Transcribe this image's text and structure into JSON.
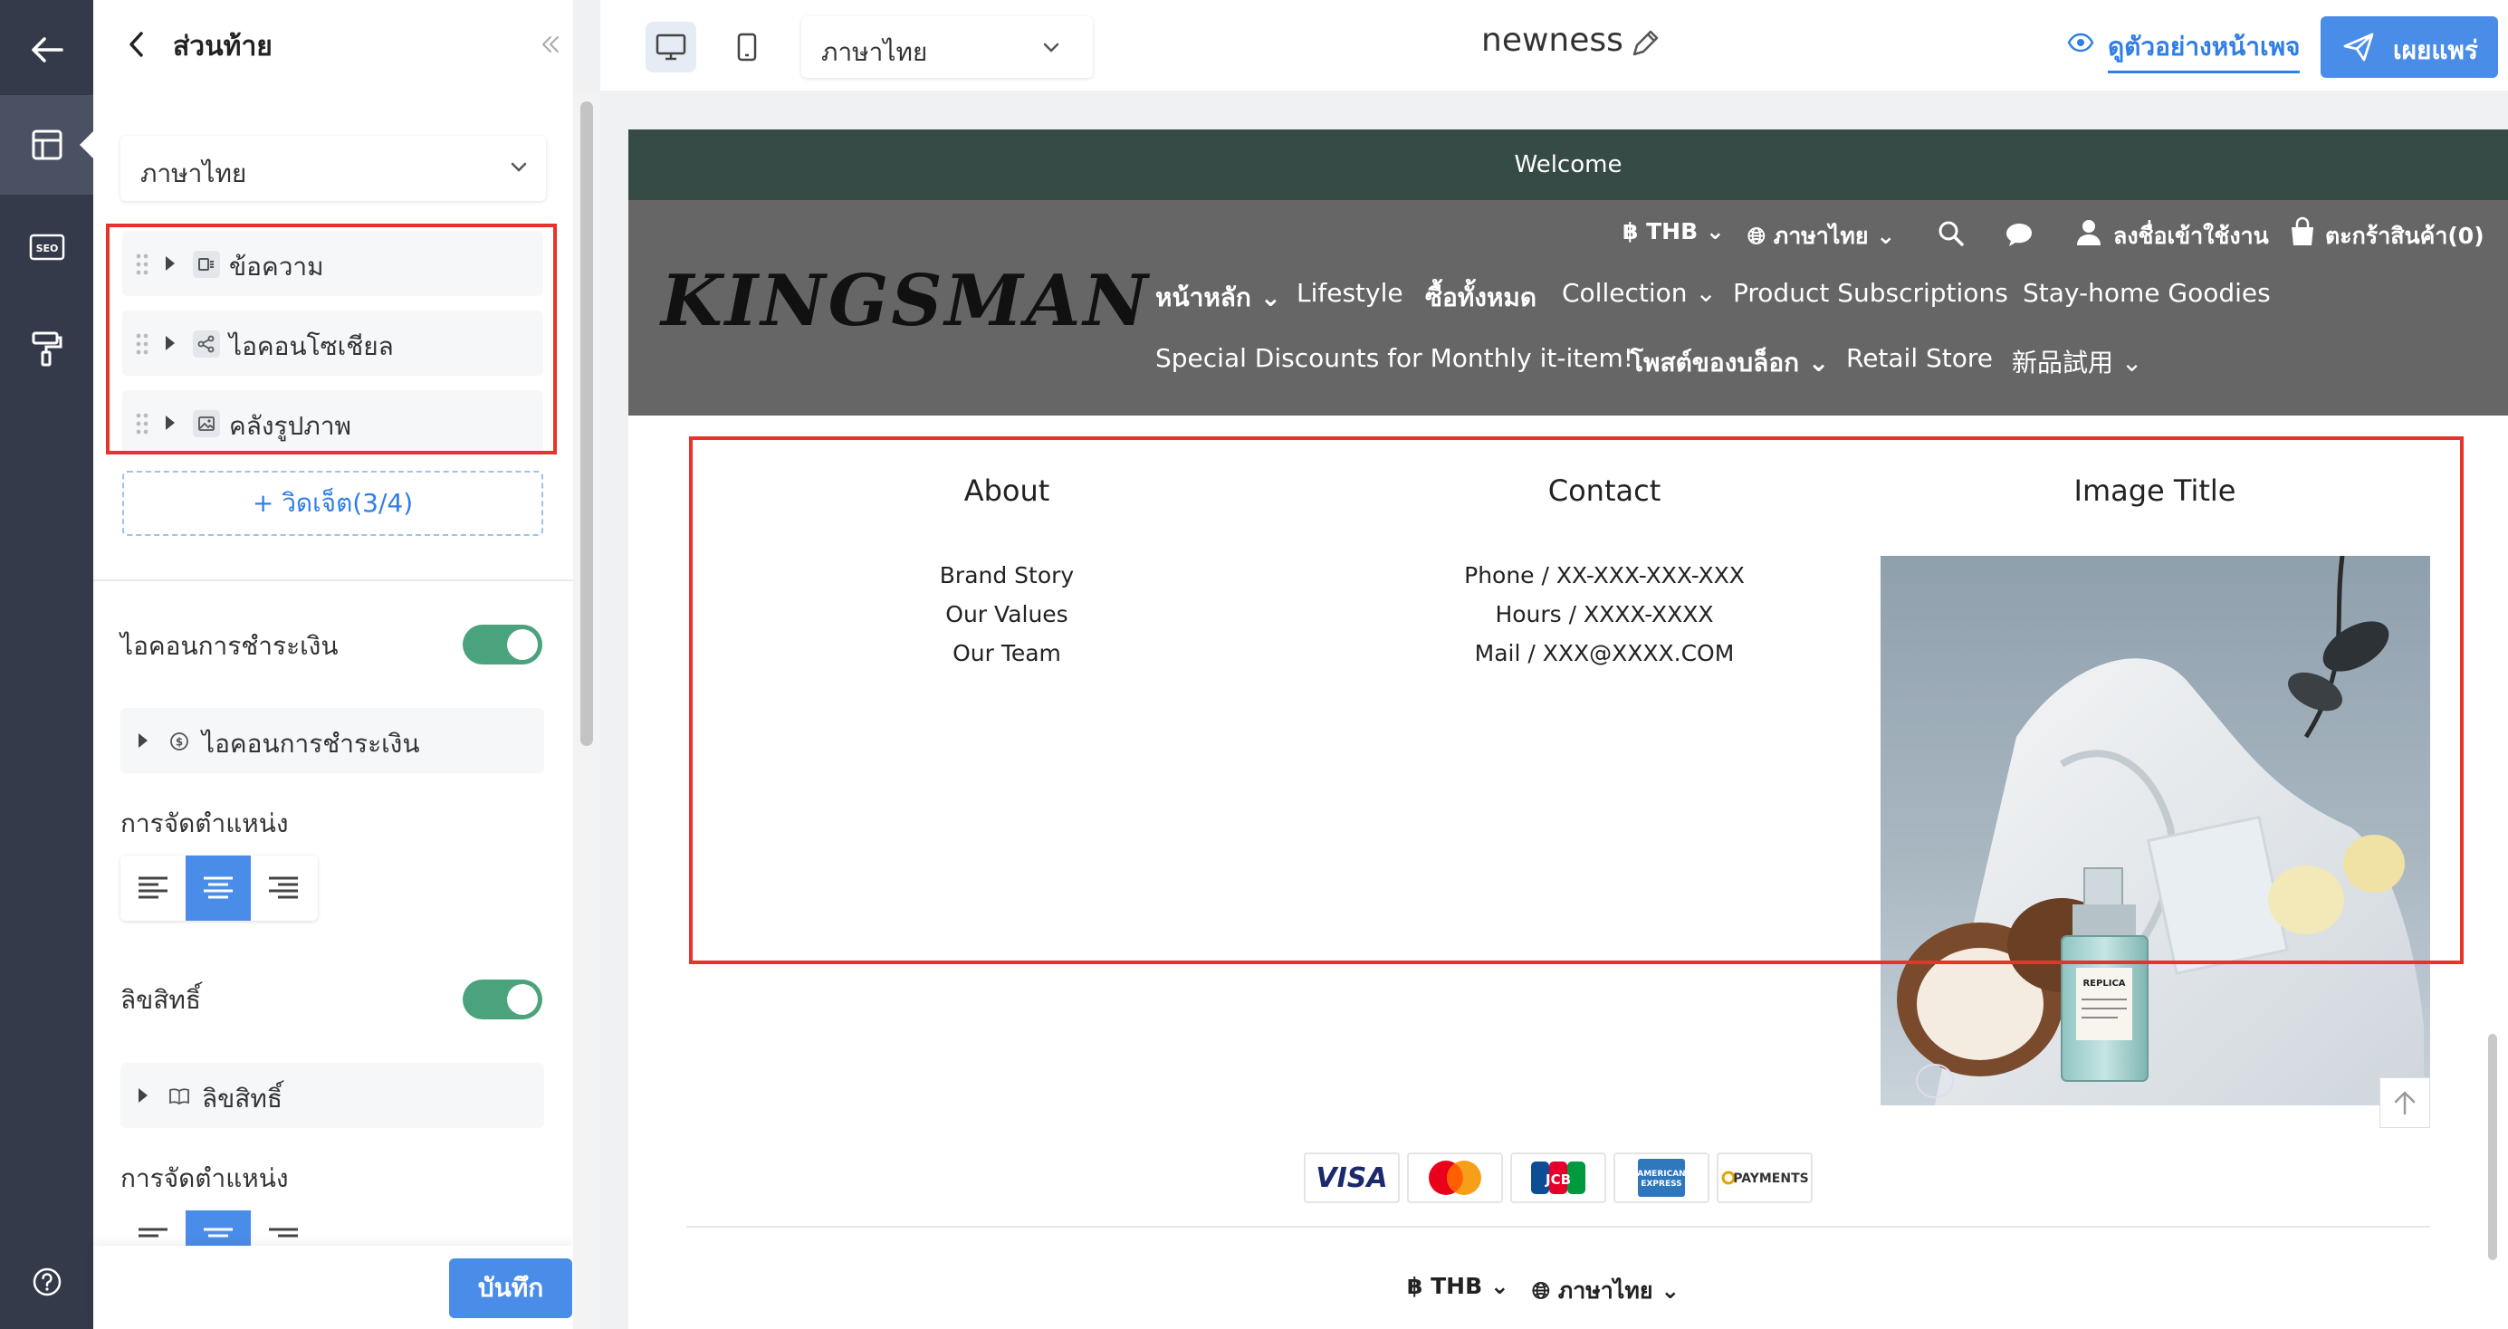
{
  "sidebar": {
    "title": "ส่วนท้าย",
    "language_select": "ภาษาไทย",
    "widgets": [
      {
        "label": "ข้อความ",
        "icon": "text-widget-icon"
      },
      {
        "label": "ไอคอนโซเชียล",
        "icon": "share-icon"
      },
      {
        "label": "คลังรูปภาพ",
        "icon": "image-icon"
      }
    ],
    "add_widget": "+ วิดเจ็ต(3/4)",
    "payment_icons_label": "ไอคอนการชำระเงิน",
    "payment_icons_row": "ไอคอนการชำระเงิน",
    "alignment_label": "การจัดตำแหน่ง",
    "copyright_label": "ลิขสิทธิ์",
    "copyright_row": "ลิขสิทธิ์",
    "alignment_label_2": "การจัดตำแหน่ง",
    "save": "บันทึก"
  },
  "toolbar": {
    "language_select": "ภาษาไทย",
    "page_name": "newness",
    "preview": "ดูตัวอย่างหน้าเพจ",
    "publish": "เผยแพร่"
  },
  "store": {
    "welcome": "Welcome",
    "logo": "KINGSMAN",
    "currency": "฿ THB",
    "language": "ภาษาไทย",
    "login": "ลงชื่อเข้าใช้งาน",
    "cart": "ตะกร้าสินค้า(0)",
    "nav_row1": [
      "หน้าหลัก",
      "Lifestyle",
      "ซื้อทั้งหมด",
      "Collection",
      "Product Subscriptions",
      "Stay-home Goodies"
    ],
    "nav_row2": [
      "Special Discounts for Monthly it-item!",
      "โพสต์ของบล็อก",
      "Retail Store",
      "新品試用"
    ]
  },
  "footer": {
    "about": {
      "title": "About",
      "items": [
        "Brand Story",
        "Our Values",
        "Our Team"
      ]
    },
    "contact": {
      "title": "Contact",
      "items": [
        "Phone / XX-XXX-XXX-XXX",
        "Hours / XXXX-XXXX",
        "Mail / XXX@XXXX.COM"
      ]
    },
    "image_title": "Image Title",
    "payments": [
      "VISA",
      "Mastercard",
      "JCB",
      "American Express",
      "PAYMENTS"
    ],
    "bottom_currency": "฿ THB",
    "bottom_language": "ภาษาไทย"
  },
  "colors": {
    "accent": "#4a8de8",
    "rail": "#343a4a",
    "welcome_bar": "#364b45",
    "store_header": "#666666",
    "toggle_on": "#4aa37c",
    "annotation": "#e8322a"
  }
}
